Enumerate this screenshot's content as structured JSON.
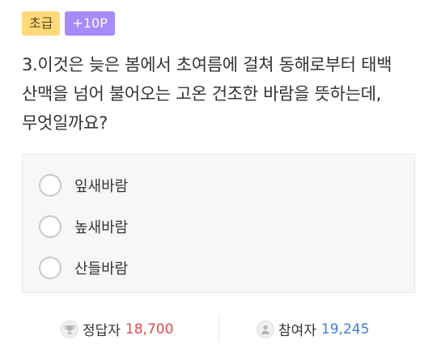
{
  "badges": {
    "level": "초급",
    "points": "+10P"
  },
  "question": {
    "line1": "3.이것은 늦은 봄에서 초여름에 걸쳐 동해로부터 태백",
    "line2": "산맥을 넘어 불어오는 고온 건조한 바람을 뜻하는데,",
    "line3": "무엇일까요?"
  },
  "options": [
    {
      "label": "잎새바람"
    },
    {
      "label": "높새바람"
    },
    {
      "label": "산들바람"
    }
  ],
  "stats": {
    "correct_label": "정답자",
    "correct_value": "18,700",
    "participants_label": "참여자",
    "participants_value": "19,245"
  },
  "colors": {
    "level_badge": "#ffd97a",
    "points_badge": "#a78bfa",
    "correct_value": "#e04a4a",
    "participants_value": "#3f7fd6"
  },
  "icons": {
    "correct": "trophy-icon",
    "participants": "person-icon"
  }
}
